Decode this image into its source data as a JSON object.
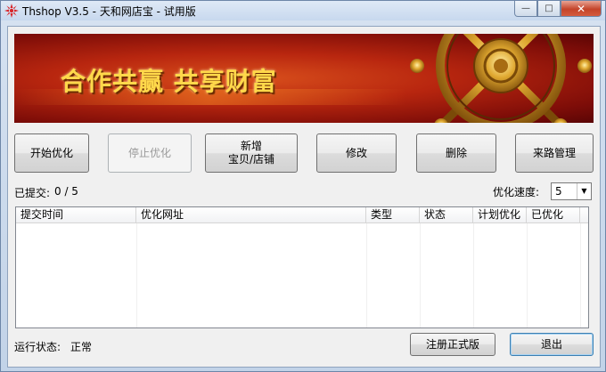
{
  "window": {
    "title": "Thshop V3.5 - 天和网店宝 - 试用版",
    "controls": {
      "minimize": "—",
      "maximize": "□",
      "close": "✕"
    }
  },
  "banner": {
    "slogan": "合作共赢  共享财富"
  },
  "toolbar": {
    "start": "开始优化",
    "stop": "停止优化",
    "add": "新增\n宝贝/店铺",
    "edit": "修改",
    "delete": "删除",
    "source": "来路管理"
  },
  "stats": {
    "submitted_label": "已提交:",
    "submitted_value": "0 / 5",
    "speed_label": "优化速度:",
    "speed_value": "5"
  },
  "table": {
    "columns": [
      "提交时间",
      "优化网址",
      "类型",
      "状态",
      "计划优化",
      "已优化"
    ],
    "rows": []
  },
  "footer": {
    "status_label": "运行状态:",
    "status_value": "正常",
    "register": "注册正式版",
    "exit": "退出"
  },
  "colors": {
    "banner_red": "#b8260f",
    "slogan_gold": "#ffd84a"
  }
}
